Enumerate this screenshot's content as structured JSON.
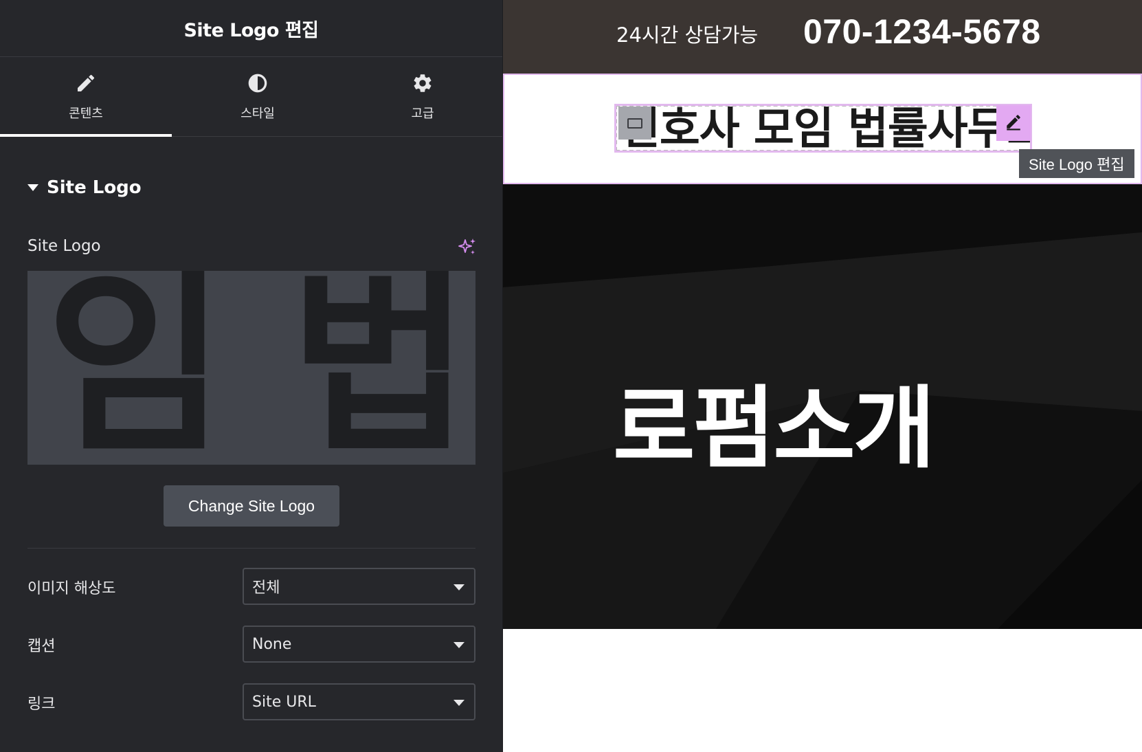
{
  "panel": {
    "title": "Site Logo 편집",
    "tabs": [
      {
        "label": "콘텐츠",
        "icon": "pencil-icon",
        "active": true
      },
      {
        "label": "스타일",
        "icon": "half-circle-icon",
        "active": false
      },
      {
        "label": "고급",
        "icon": "gear-icon",
        "active": false
      }
    ],
    "section": {
      "title": "Site Logo",
      "expanded": true
    },
    "logo_control": {
      "label": "Site Logo",
      "ai_icon": "sparkle-icon",
      "preview_text": "!임 법"
    },
    "change_button": "Change Site Logo",
    "fields": [
      {
        "label": "이미지 해상도",
        "value": "전체"
      },
      {
        "label": "캡션",
        "value": "None"
      },
      {
        "label": "링크",
        "value": "Site URL"
      }
    ]
  },
  "preview": {
    "topbar": {
      "text": "24시간 상담가능",
      "phone": "070-1234-5678"
    },
    "logo_widget": {
      "text": "변호사 모임 법률사무소",
      "tooltip": "Site Logo 편집",
      "edit_icon": "pencil-icon",
      "handle_icon": "widget-handle-icon"
    },
    "hero": {
      "title": "로펌소개"
    }
  },
  "colors": {
    "panel_bg": "#26272b",
    "topbar_bg": "#3b3532",
    "selection_accent": "#e2b8ee",
    "edit_button": "#e3a9f2",
    "hero_bg": "#161616"
  }
}
